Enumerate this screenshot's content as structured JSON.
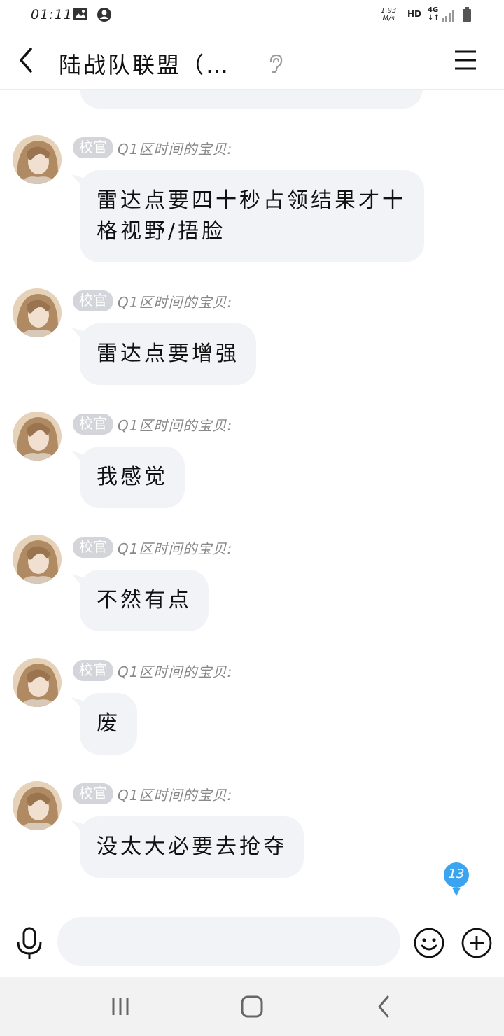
{
  "status_bar": {
    "time": "01:11",
    "speed_value": "1.93",
    "speed_unit": "M/s",
    "hd": "HD",
    "network": "4G"
  },
  "header": {
    "title": "陆战队联盟（…"
  },
  "messages": [
    {
      "badge": "校官",
      "sender": "Q1区时间的宝贝:",
      "text": "雷达点要四十秒占领结果才十格视野/捂脸"
    },
    {
      "badge": "校官",
      "sender": "Q1区时间的宝贝:",
      "text": "雷达点要增强"
    },
    {
      "badge": "校官",
      "sender": "Q1区时间的宝贝:",
      "text": "我感觉"
    },
    {
      "badge": "校官",
      "sender": "Q1区时间的宝贝:",
      "text": "不然有点"
    },
    {
      "badge": "校官",
      "sender": "Q1区时间的宝贝:",
      "text": "废"
    },
    {
      "badge": "校官",
      "sender": "Q1区时间的宝贝:",
      "text": "没太大必要去抢夺"
    }
  ],
  "unread_count": "13",
  "input": {
    "placeholder": "",
    "value": ""
  },
  "colors": {
    "bubble": "#f2f3f7",
    "badge": "#d3d5da",
    "unread": "#3ba4f0"
  }
}
